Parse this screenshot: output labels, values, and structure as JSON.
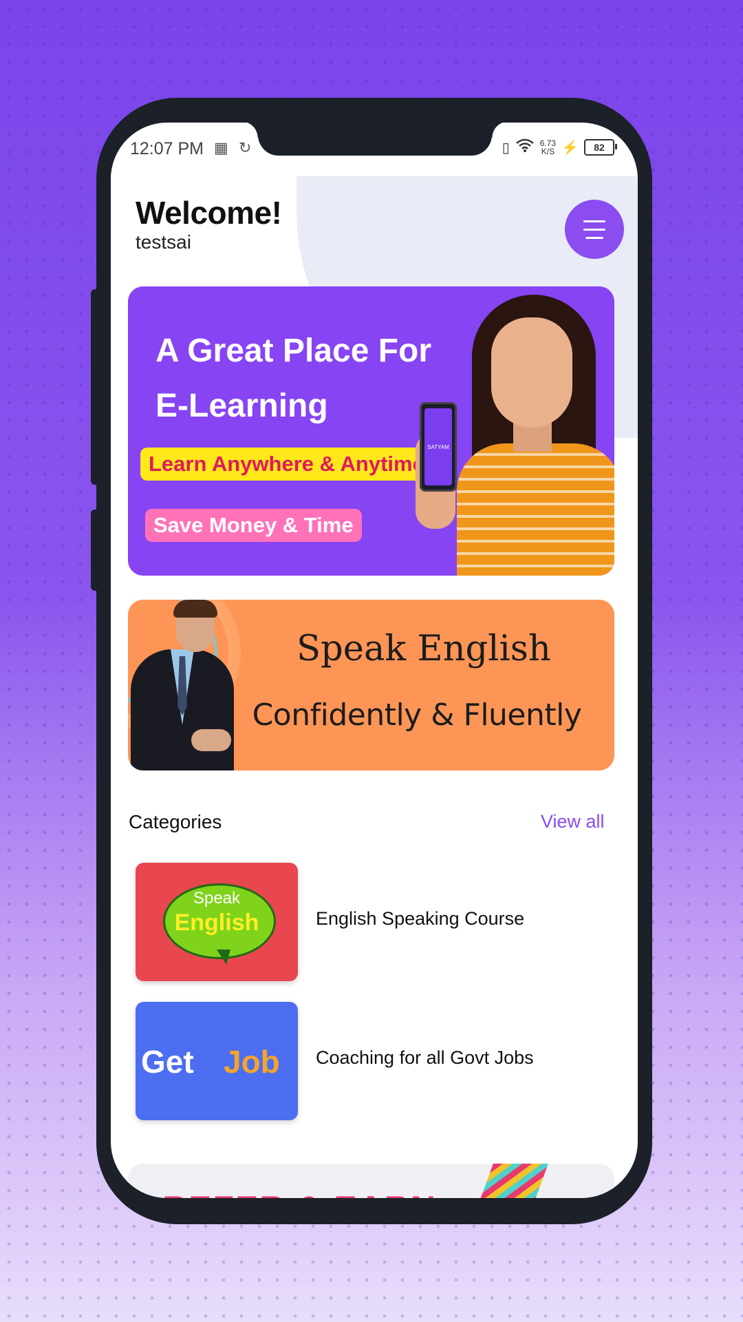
{
  "status_bar": {
    "time": "12:07 PM",
    "net_speed_value": "6.73",
    "net_speed_unit": "K/S",
    "battery": "82",
    "icons": [
      "screen-cast-icon",
      "sync-icon",
      "vibrate-icon",
      "wifi-icon",
      "charging-icon",
      "battery-icon"
    ]
  },
  "header": {
    "welcome": "Welcome!",
    "username": "testsai",
    "menu_icon": "hamburger-menu-icon"
  },
  "banners": [
    {
      "title_line1": "A Great Place For",
      "title_line2": "E-Learning",
      "chip1": "Learn Anywhere & Anytime",
      "chip2": "Save Money & Time",
      "phone_brand": "SATYAM"
    },
    {
      "line1": "Speak English",
      "line2": "Confidently & Fluently"
    }
  ],
  "categories": {
    "title": "Categories",
    "view_all": "View all",
    "items": [
      {
        "thumb_top": "Speak",
        "thumb_main": "English",
        "label": "English Speaking Course"
      },
      {
        "thumb_left": "Get",
        "thumb_right": "Job",
        "label": "Coaching for all Govt Jobs"
      }
    ]
  },
  "refer_card": {
    "text": "REFER & EARN"
  },
  "colors": {
    "accent": "#8b4cf0",
    "banner1_bg": "#8744f3",
    "banner2_bg": "#fd9556",
    "chip_yellow": "#ffe81a",
    "chip_pink": "#ff72b8"
  }
}
